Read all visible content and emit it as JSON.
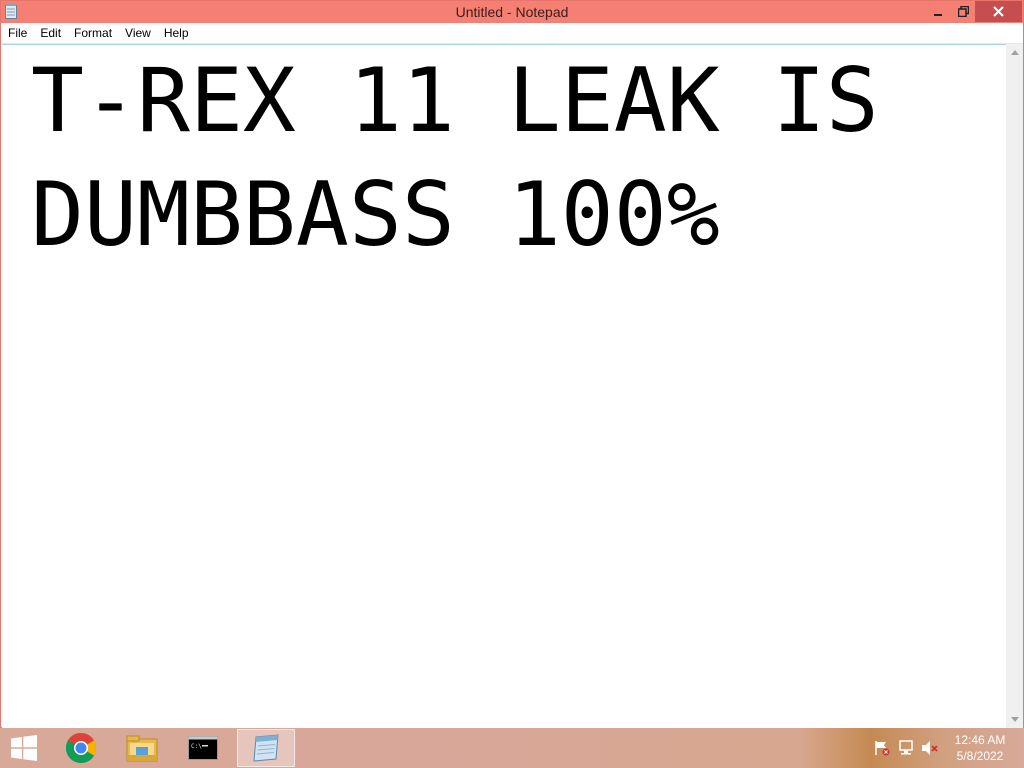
{
  "window": {
    "title": "Untitled - Notepad"
  },
  "menu": {
    "items": [
      "File",
      "Edit",
      "Format",
      "View",
      "Help"
    ]
  },
  "editor": {
    "lines": [
      "T-REX 11 LEAK IS",
      "DUMBBASS 100%"
    ]
  },
  "taskbar": {
    "apps": [
      "chrome-icon",
      "file-explorer-icon",
      "command-prompt-icon",
      "notepad-icon"
    ],
    "active_app": "notepad-icon",
    "tray": [
      "action-center-flag-icon",
      "network-icon",
      "volume-muted-icon"
    ],
    "clock": {
      "time": "12:46 AM",
      "date": "5/8/2022"
    }
  },
  "colors": {
    "titlebar": "#f47f72",
    "close_button": "#c74e4e",
    "taskbar": "#d8a898"
  }
}
